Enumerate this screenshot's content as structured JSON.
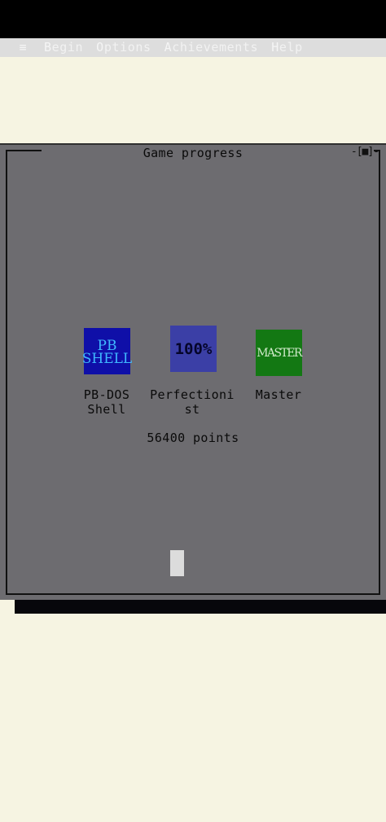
{
  "menubar": {
    "icon": "hamburger-icon",
    "items": [
      {
        "hot": "B",
        "rest": "egin"
      },
      {
        "hot": "O",
        "rest": "ptions"
      },
      {
        "hot": "A",
        "rest": "chievements"
      },
      {
        "hot": "H",
        "rest": "elp"
      }
    ]
  },
  "window": {
    "title": "Game progress",
    "control": "[■]"
  },
  "achievements": [
    {
      "badge_text": "PB SHELL",
      "badge_line1": "PB",
      "badge_line2": "SHELL",
      "label_line1": "PB-DOS",
      "label_line2": "Shell"
    },
    {
      "badge_text": "100%",
      "label_line1": "Perfectioni",
      "label_line2": "st"
    },
    {
      "badge_text": "MASTER",
      "label_line1": "Master",
      "label_line2": ""
    }
  ],
  "score": {
    "text": "56400 points"
  },
  "colors": {
    "desktop": "#f6f4e2",
    "window": "#6d6c70",
    "pb_shell": "#0f0fa8",
    "perfectionist": "#3b3fa6",
    "master": "#137813"
  }
}
